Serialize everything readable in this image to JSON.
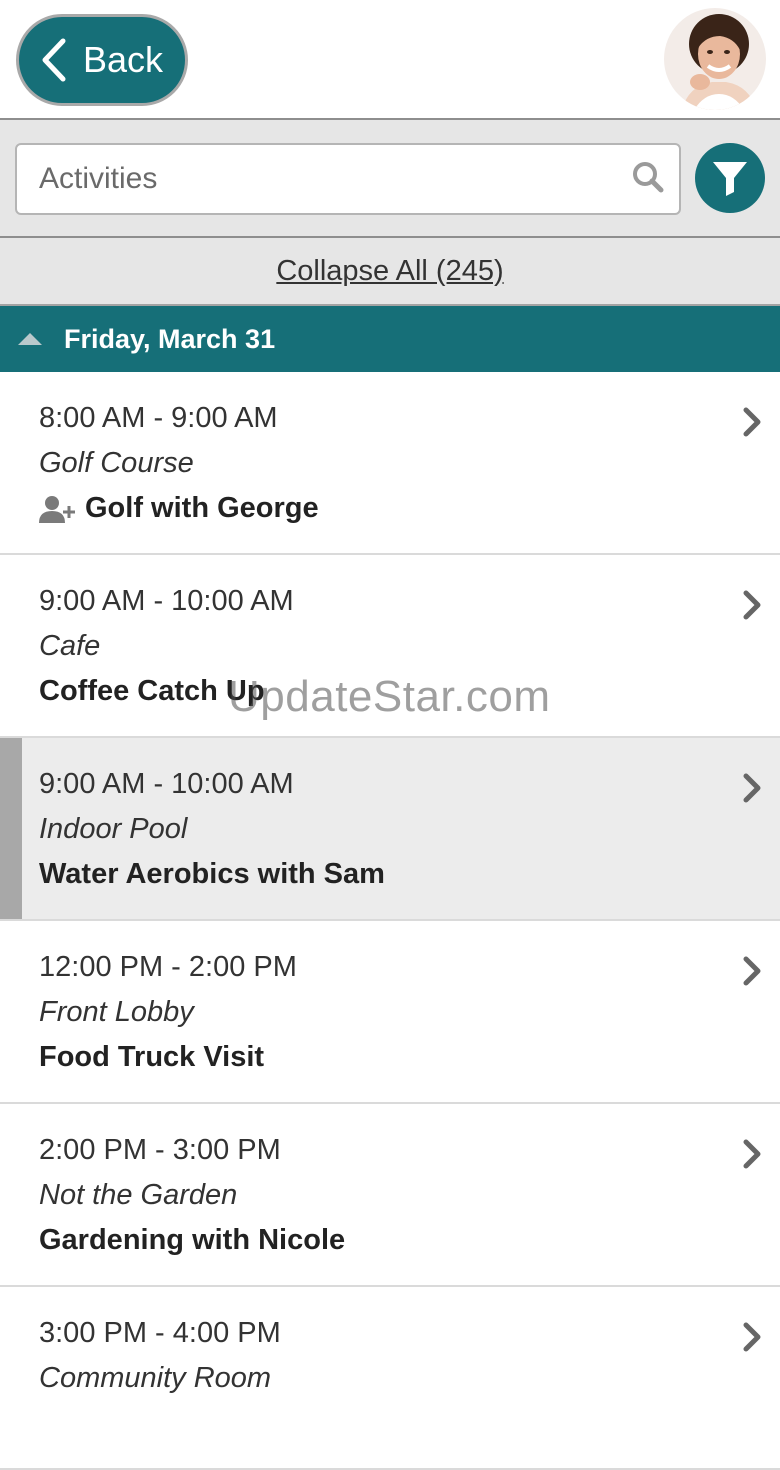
{
  "header": {
    "back_label": "Back"
  },
  "search": {
    "placeholder": "Activities"
  },
  "collapse": {
    "label": "Collapse All (245)"
  },
  "day": {
    "title": "Friday, March 31"
  },
  "activities": [
    {
      "time": "8:00 AM - 9:00 AM",
      "location": "Golf Course",
      "title": "Golf with George",
      "has_guest_icon": true,
      "selected": false
    },
    {
      "time": "9:00 AM - 10:00 AM",
      "location": "Cafe",
      "title": "Coffee Catch Up",
      "has_guest_icon": false,
      "selected": false
    },
    {
      "time": "9:00 AM - 10:00 AM",
      "location": "Indoor Pool",
      "title": "Water Aerobics with Sam",
      "has_guest_icon": false,
      "selected": true
    },
    {
      "time": "12:00 PM - 2:00 PM",
      "location": "Front Lobby",
      "title": "Food Truck Visit",
      "has_guest_icon": false,
      "selected": false
    },
    {
      "time": "2:00 PM - 3:00 PM",
      "location": "Not the Garden",
      "title": "Gardening with Nicole",
      "has_guest_icon": false,
      "selected": false
    },
    {
      "time": "3:00 PM - 4:00 PM",
      "location": "Community Room",
      "title": "",
      "has_guest_icon": false,
      "selected": false
    }
  ],
  "watermark": "UpdateStar.com",
  "colors": {
    "accent": "#166f78",
    "header_bg": "#e6e6e6",
    "selected_bg": "#ececec"
  }
}
